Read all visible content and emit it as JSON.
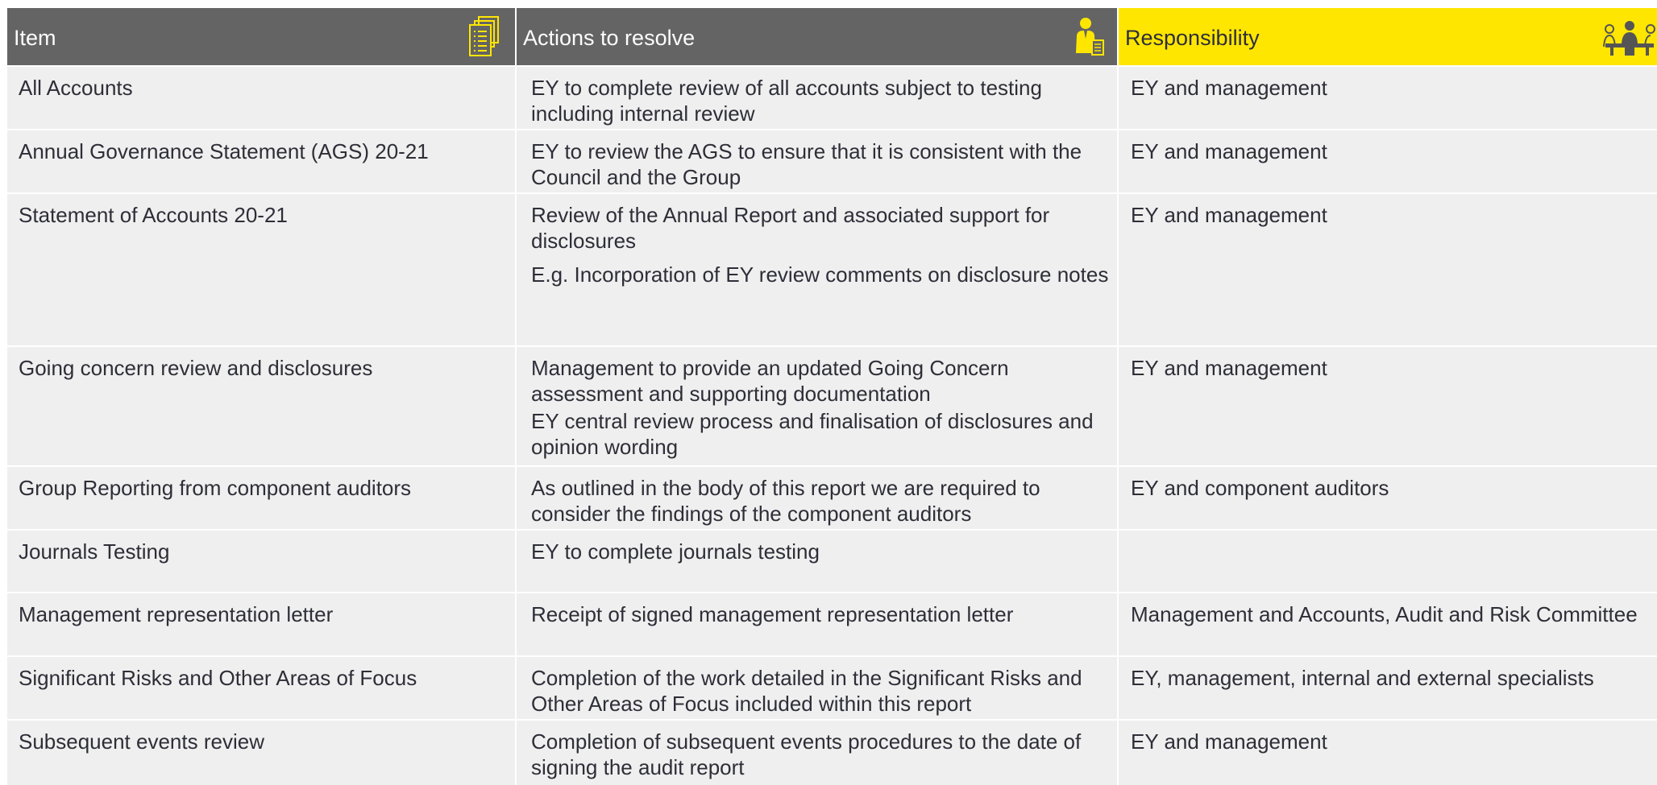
{
  "header": {
    "item": "Item",
    "actions": "Actions to resolve",
    "responsibility": "Responsibility",
    "item_icon": "document-stack-icon",
    "actions_icon": "person-with-document-icon",
    "responsibility_icon": "meeting-people-icon"
  },
  "colors": {
    "header_grey": "#646464",
    "accent_yellow": "#ffe600",
    "row_bg": "#efefef",
    "text": "#2e2e38"
  },
  "rows": [
    {
      "item": "All Accounts",
      "actions": [
        "EY to complete review of all accounts subject to testing including internal review"
      ],
      "responsibility": "EY and management"
    },
    {
      "item": "Annual Governance Statement (AGS) 20-21",
      "actions": [
        "EY to review the AGS to ensure that it is consistent with the Council and the Group"
      ],
      "responsibility": "EY and management"
    },
    {
      "item": "Statement of Accounts 20-21",
      "actions": [
        "Review of the Annual Report and associated support for disclosures",
        "E.g. Incorporation of EY review comments on disclosure notes"
      ],
      "responsibility": "EY and management"
    },
    {
      "item": "Going concern review and disclosures",
      "actions": [
        "Management to provide an updated Going Concern assessment and supporting documentation",
        "EY central review process and finalisation of disclosures and opinion wording"
      ],
      "responsibility": "EY and management"
    },
    {
      "item": "Group Reporting from component auditors",
      "actions": [
        "As outlined in the body of this report we are required to consider the findings of the component auditors"
      ],
      "responsibility": "EY and component auditors"
    },
    {
      "item": "Journals Testing",
      "actions": [
        "EY to complete journals testing"
      ],
      "responsibility": ""
    },
    {
      "item": "Management representation letter",
      "actions": [
        "Receipt of signed management representation letter"
      ],
      "responsibility": "Management and Accounts, Audit and Risk Committee"
    },
    {
      "item": "Significant Risks and Other Areas of Focus",
      "actions": [
        "Completion of the work detailed in the Significant Risks and Other Areas of Focus included within this report"
      ],
      "responsibility": "EY, management, internal and external specialists"
    },
    {
      "item": "Subsequent events review",
      "actions": [
        "Completion of subsequent events procedures to the date of signing the audit report"
      ],
      "responsibility": "EY and management"
    }
  ]
}
